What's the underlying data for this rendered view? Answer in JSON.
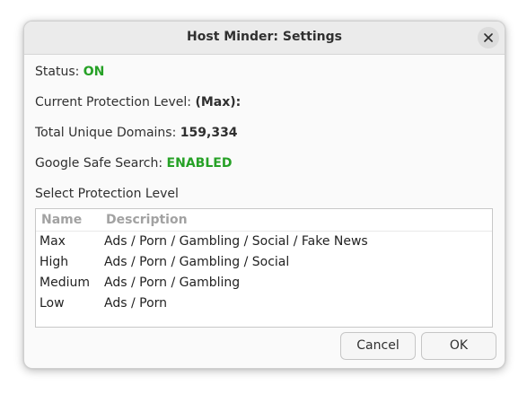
{
  "window": {
    "title": "Host Minder: Settings"
  },
  "status": {
    "label": "Status:",
    "value": "ON"
  },
  "protection_level": {
    "label": "Current Protection Level:",
    "value": "(Max):"
  },
  "domains": {
    "label": "Total Unique Domains:",
    "value": "159,334"
  },
  "safe_search": {
    "label": "Google Safe Search:",
    "value": "ENABLED"
  },
  "select_label": "Select Protection Level",
  "list": {
    "columns": [
      "Name",
      "Description"
    ],
    "rows": [
      {
        "name": "Max",
        "description": "Ads / Porn / Gambling / Social / Fake News"
      },
      {
        "name": "High",
        "description": "Ads / Porn / Gambling / Social"
      },
      {
        "name": "Medium",
        "description": "Ads / Porn / Gambling"
      },
      {
        "name": "Low",
        "description": "Ads / Porn"
      }
    ]
  },
  "buttons": {
    "cancel": "Cancel",
    "ok": "OK"
  },
  "colors": {
    "status_green": "#26a126"
  },
  "icons": {
    "close": "close-icon"
  }
}
